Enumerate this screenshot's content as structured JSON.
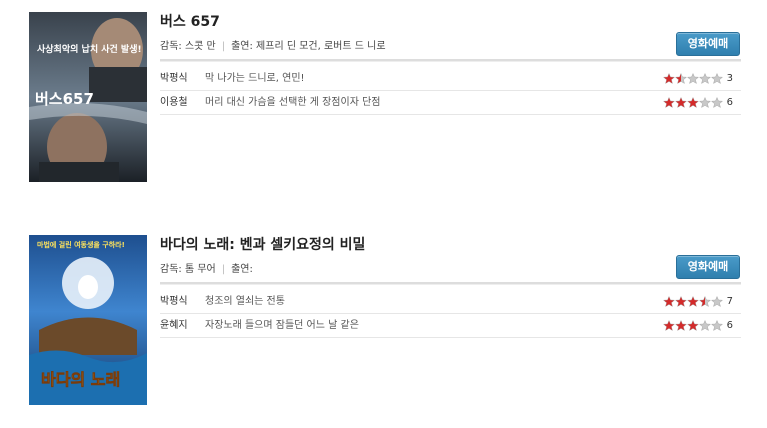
{
  "buttons": {
    "book_label": "영화예매"
  },
  "movies": [
    {
      "title": "버스 657",
      "director_label": "감독: 스콧 만",
      "cast_label": "출연: 제프리 딘 모건, 로버트 드 니로",
      "poster": {
        "tagline": "사상최악의 납치 사건 발생!",
        "title_text": "버스657",
        "colors": {
          "sky": "#5a6a7a",
          "dark": "#1d2228",
          "accent": "#f0f0f0"
        }
      },
      "reviews": [
        {
          "name": "박평식",
          "comment": "막 나가는 드니로, 연민!",
          "score": "3",
          "rating": 1.5
        },
        {
          "name": "이용철",
          "comment": "머리 대신 가슴을 선택한 게 장점이자 단점",
          "score": "6",
          "rating": 3
        }
      ]
    },
    {
      "title": "바다의 노래: 벤과 셀키요정의 비밀",
      "director_label": "감독: 톰 무어",
      "cast_label": "출연:",
      "poster": {
        "tagline": "마법에 걸린 여동생을 구하라!",
        "title_text": "바다의 노래",
        "colors": {
          "sky": "#2f6fb8",
          "dark": "#0f3d6e",
          "accent": "#ffd84a"
        }
      },
      "reviews": [
        {
          "name": "박평식",
          "comment": "청조의 열쇠는 전통",
          "score": "7",
          "rating": 3.5
        },
        {
          "name": "윤혜지",
          "comment": "자장노래 들으며 잠들던 어느 날 같은",
          "score": "6",
          "rating": 3
        }
      ]
    }
  ],
  "colors": {
    "star_on": "#d42a2a",
    "star_off": "#c8c8c8",
    "button": "#3a8bbd"
  }
}
